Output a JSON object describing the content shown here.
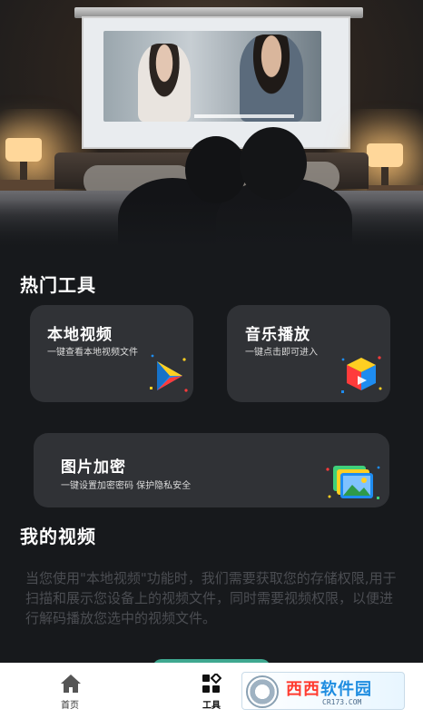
{
  "hot_tools": {
    "title": "热门工具",
    "cards": [
      {
        "title": "本地视频",
        "desc": "一键查看本地视频文件",
        "icon": "play-triangle-icon"
      },
      {
        "title": "音乐播放",
        "desc": "一键点击即可进入",
        "icon": "cube-icon"
      },
      {
        "title": "图片加密",
        "desc": "一键设置加密密码  保护隐私安全",
        "icon": "photo-stack-icon"
      }
    ]
  },
  "my_videos": {
    "title": "我的视频",
    "notice": "当您使用\"本地视频\"功能时，我们需要获取您的存储权限,用于扫描和展示您设备上的视频文件，同时需要视频权限，以便进行解码播放您选中的视频文件。"
  },
  "bottom_nav": {
    "items": [
      {
        "label": "首页",
        "icon": "home-icon"
      },
      {
        "label": "工具",
        "icon": "grid-diamond-icon",
        "active": true
      }
    ]
  },
  "watermark": {
    "name_red": "西西",
    "name_blue": "软件园",
    "url": "CR173.COM"
  },
  "colors": {
    "background": "#17191c",
    "card": "#303236",
    "notice_text": "#4b4d52",
    "accent_green": "#3fa890"
  }
}
